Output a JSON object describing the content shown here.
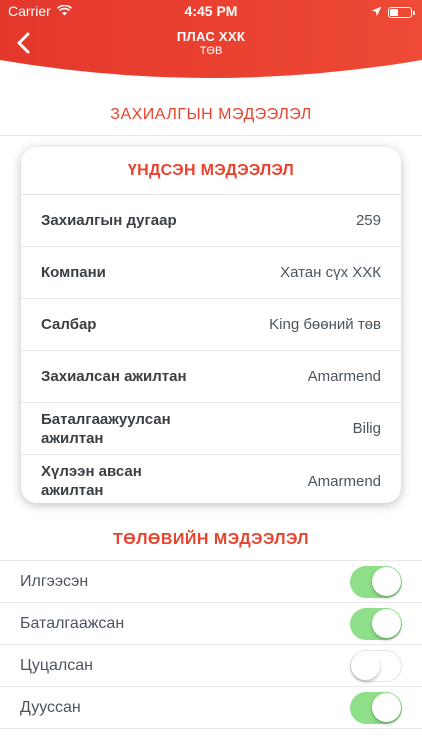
{
  "status_bar": {
    "carrier": "Carrier",
    "time": "4:45 PM"
  },
  "nav": {
    "title": "ПЛАС ХХК",
    "subtitle": "ТӨВ"
  },
  "order_section": {
    "title": "ЗАХИАЛГЫН МЭДЭЭЛЭЛ"
  },
  "basic_info": {
    "title": "ҮНДСЭН МЭДЭЭЛЭЛ",
    "rows": [
      {
        "label": "Захиалгын дугаар",
        "value": "259"
      },
      {
        "label": "Компани",
        "value": "Хатан сүх ХХК"
      },
      {
        "label": "Салбар",
        "value": "King бөөний төв"
      },
      {
        "label": "Захиалсан ажилтан",
        "value": "Amarmend"
      },
      {
        "label": "Баталгаажуулсан ажилтан",
        "value": "Bilig"
      },
      {
        "label": "Хүлээн авсан ажилтан",
        "value": "Amarmend"
      }
    ]
  },
  "status_section": {
    "title": "ТӨЛӨВИЙН МЭДЭЭЛЭЛ",
    "items": [
      {
        "label": "Илгээсэн",
        "on": true
      },
      {
        "label": "Баталгаажсан",
        "on": true
      },
      {
        "label": "Цуцалсан",
        "on": false
      },
      {
        "label": "Дууссан",
        "on": true
      }
    ]
  },
  "colors": {
    "accent": "#e8432e",
    "toggle_on": "#8ede8a"
  },
  "icons": {
    "back": "chevron-left-icon",
    "wifi": "wifi-icon",
    "location": "location-arrow-icon",
    "battery": "battery-icon"
  }
}
